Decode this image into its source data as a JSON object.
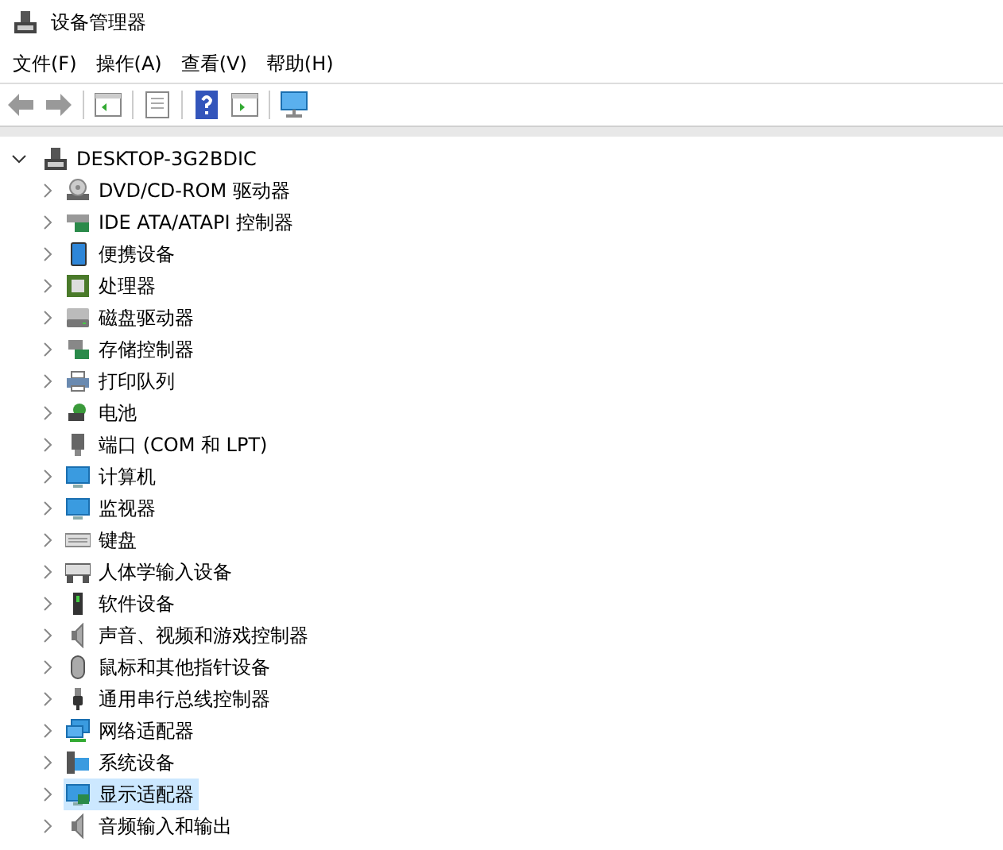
{
  "window": {
    "title": "设备管理器"
  },
  "menu": [
    "文件(F)",
    "操作(A)",
    "查看(V)",
    "帮助(H)"
  ],
  "tree": {
    "label": "DESKTOP-3G2BDIC",
    "expanded": true,
    "children": [
      {
        "label": "DVD/CD-ROM 驱动器",
        "kind": "disc",
        "expanded": false,
        "selected": false
      },
      {
        "label": "IDE ATA/ATAPI 控制器",
        "kind": "controller",
        "expanded": false,
        "selected": false
      },
      {
        "label": "便携设备",
        "kind": "portable",
        "expanded": false,
        "selected": false
      },
      {
        "label": "处理器",
        "kind": "cpu",
        "expanded": false,
        "selected": false
      },
      {
        "label": "磁盘驱动器",
        "kind": "disk",
        "expanded": false,
        "selected": false
      },
      {
        "label": "存储控制器",
        "kind": "storage",
        "expanded": false,
        "selected": false
      },
      {
        "label": "打印队列",
        "kind": "printer",
        "expanded": false,
        "selected": false
      },
      {
        "label": "电池",
        "kind": "battery",
        "expanded": false,
        "selected": false
      },
      {
        "label": "端口 (COM 和 LPT)",
        "kind": "port",
        "expanded": false,
        "selected": false
      },
      {
        "label": "计算机",
        "kind": "monitor",
        "expanded": false,
        "selected": false
      },
      {
        "label": "监视器",
        "kind": "monitor",
        "expanded": false,
        "selected": false
      },
      {
        "label": "键盘",
        "kind": "keyboard",
        "expanded": false,
        "selected": false
      },
      {
        "label": "人体学输入设备",
        "kind": "hid",
        "expanded": false,
        "selected": false
      },
      {
        "label": "软件设备",
        "kind": "software",
        "expanded": false,
        "selected": false
      },
      {
        "label": "声音、视频和游戏控制器",
        "kind": "speaker",
        "expanded": false,
        "selected": false
      },
      {
        "label": "鼠标和其他指针设备",
        "kind": "mouse",
        "expanded": false,
        "selected": false
      },
      {
        "label": "通用串行总线控制器",
        "kind": "usb",
        "expanded": false,
        "selected": false
      },
      {
        "label": "网络适配器",
        "kind": "network",
        "expanded": false,
        "selected": false
      },
      {
        "label": "系统设备",
        "kind": "system",
        "expanded": false,
        "selected": false
      },
      {
        "label": "显示适配器",
        "kind": "display",
        "expanded": false,
        "selected": true
      },
      {
        "label": "音频输入和输出",
        "kind": "speaker",
        "expanded": false,
        "selected": false
      }
    ]
  }
}
